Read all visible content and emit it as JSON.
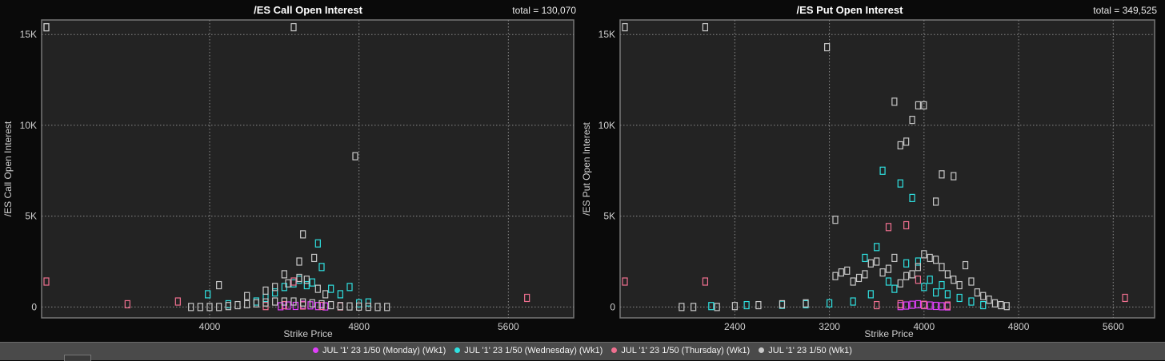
{
  "colors": {
    "background": "#0a0a0a",
    "plot_background": "#232323",
    "grid": "#8a8a8a",
    "monday": "#e040fb",
    "wednesday": "#2fe0e0",
    "thursday": "#f07090",
    "weekly": "#c8c8c8"
  },
  "legend": [
    {
      "label": "JUL '1' 23 1/50 (Monday) (Wk1)",
      "color": "#e040fb"
    },
    {
      "label": "JUL '1' 23 1/50 (Wednesday) (Wk1)",
      "color": "#2fe0e0"
    },
    {
      "label": "JUL '1' 23 1/50 (Thursday) (Wk1)",
      "color": "#f07090"
    },
    {
      "label": "JUL '1' 23 1/50 (Wk1)",
      "color": "#c8c8c8"
    }
  ],
  "chart_data": [
    {
      "type": "scatter",
      "title": "/ES Call Open Interest",
      "total_label": "total = 130,070",
      "xlabel": "Strike Price",
      "ylabel": "/ES Call Open Interest",
      "xlim": [
        3100,
        5950
      ],
      "ylim": [
        -600,
        15800
      ],
      "xticks": [
        4000,
        4800,
        5600
      ],
      "xtick_labels": [
        "4000",
        "4800",
        "5600"
      ],
      "yticks": [
        0,
        5000,
        10000,
        15000
      ],
      "ytick_labels": [
        "0",
        "5K",
        "10K",
        "15K"
      ],
      "grid": true,
      "series": [
        {
          "name": "JUL '1' 23 1/50 (Monday) (Wk1)",
          "color": "#e040fb",
          "x": [
            4380,
            4420,
            4460,
            4500,
            4540,
            4580,
            4620
          ],
          "y": [
            40,
            80,
            60,
            120,
            90,
            50,
            30
          ]
        },
        {
          "name": "JUL '1' 23 1/50 (Wednesday) (Wk1)",
          "color": "#2fe0e0",
          "x": [
            3990,
            4100,
            4250,
            4300,
            4350,
            4400,
            4450,
            4480,
            4520,
            4550,
            4580,
            4600,
            4650,
            4700,
            4750,
            4800,
            4850
          ],
          "y": [
            700,
            150,
            300,
            500,
            800,
            1100,
            1300,
            1500,
            1200,
            1350,
            3500,
            2200,
            1000,
            700,
            1100,
            200,
            250
          ]
        },
        {
          "name": "JUL '1' 23 1/50 (Thursday) (Wk1)",
          "color": "#f07090",
          "x": [
            3105,
            3560,
            3830,
            4450,
            5700,
            4300,
            4400,
            4500,
            4600,
            4700
          ],
          "y": [
            1400,
            150,
            300,
            1400,
            500,
            50,
            100,
            80,
            60,
            30
          ]
        },
        {
          "name": "JUL '1' 23 1/50 (Wk1)",
          "color": "#c8c8c8",
          "x": [
            3105,
            3100,
            4450,
            4780,
            4500,
            4050,
            4400,
            4480,
            4520,
            4560,
            3900,
            3950,
            4000,
            4050,
            4100,
            4150,
            4200,
            4250,
            4300,
            4350,
            4400,
            4450,
            4500,
            4550,
            4600,
            4650,
            4700,
            4750,
            4800,
            4850,
            4900,
            4950,
            4200,
            4300,
            4350,
            4420,
            4480,
            4580,
            4620
          ],
          "y": [
            15400,
            15400,
            15400,
            8300,
            4000,
            1200,
            1800,
            2500,
            1500,
            2700,
            0,
            0,
            0,
            0,
            50,
            100,
            150,
            200,
            250,
            300,
            300,
            300,
            250,
            200,
            150,
            100,
            50,
            30,
            20,
            10,
            0,
            0,
            600,
            900,
            1100,
            1300,
            1600,
            1000,
            700
          ]
        }
      ]
    },
    {
      "type": "scatter",
      "title": "/ES Put Open Interest",
      "total_label": "total = 349,525",
      "xlabel": "Strike Price",
      "ylabel": "/ES Put Open Interest",
      "xlim": [
        1430,
        5950
      ],
      "ylim": [
        -600,
        15800
      ],
      "xticks": [
        2400,
        3200,
        4000,
        4800,
        5600
      ],
      "xtick_labels": [
        "2400",
        "3200",
        "4000",
        "4800",
        "5600"
      ],
      "yticks": [
        0,
        5000,
        10000,
        15000
      ],
      "ytick_labels": [
        "0",
        "5K",
        "10K",
        "15K"
      ],
      "grid": true,
      "series": [
        {
          "name": "JUL '1' 23 1/50 (Monday) (Wk1)",
          "color": "#e040fb",
          "x": [
            3800,
            3850,
            3900,
            3950,
            4000,
            4050,
            4100,
            4150,
            4200
          ],
          "y": [
            50,
            80,
            120,
            150,
            100,
            80,
            60,
            40,
            30
          ]
        },
        {
          "name": "JUL '1' 23 1/50 (Wednesday) (Wk1)",
          "color": "#2fe0e0",
          "x": [
            2200,
            2500,
            2800,
            3000,
            3200,
            3400,
            3500,
            3550,
            3600,
            3650,
            3700,
            3750,
            3800,
            3850,
            3900,
            3950,
            4000,
            4050,
            4100,
            4150,
            4200,
            4300,
            4400,
            4500
          ],
          "y": [
            50,
            100,
            120,
            150,
            200,
            300,
            2700,
            700,
            3300,
            7500,
            1400,
            1000,
            6800,
            2400,
            6000,
            2500,
            1100,
            1500,
            800,
            1200,
            700,
            500,
            300,
            100
          ]
        },
        {
          "name": "JUL '1' 23 1/50 (Thursday) (Wk1)",
          "color": "#f07090",
          "x": [
            1450,
            2150,
            3700,
            3850,
            3950,
            5700,
            3600,
            3800,
            4000,
            4200
          ],
          "y": [
            1400,
            1400,
            4400,
            4500,
            1500,
            500,
            100,
            150,
            120,
            80
          ]
        },
        {
          "name": "JUL '1' 23 1/50 (Wk1)",
          "color": "#c8c8c8",
          "x": [
            1450,
            2150,
            3180,
            3750,
            3900,
            3950,
            4000,
            3850,
            3800,
            4150,
            4250,
            4100,
            3250,
            3250,
            3300,
            3350,
            3400,
            3450,
            3500,
            3550,
            3600,
            3650,
            3700,
            3750,
            3800,
            3850,
            3900,
            3950,
            4000,
            4050,
            4100,
            4150,
            4200,
            4250,
            4300,
            4350,
            4400,
            4450,
            4500,
            4550,
            4600,
            4650,
            4700,
            1950,
            2050,
            2250,
            2400,
            2600,
            2800,
            3000
          ],
          "y": [
            15400,
            15400,
            14300,
            11300,
            10300,
            11100,
            11100,
            9100,
            8900,
            7300,
            7200,
            5800,
            4800,
            1700,
            1900,
            2000,
            1400,
            1600,
            1800,
            2400,
            2500,
            1900,
            2100,
            2700,
            1300,
            1700,
            1800,
            2200,
            2900,
            2700,
            2600,
            2200,
            1800,
            1500,
            1200,
            2300,
            1400,
            800,
            600,
            400,
            200,
            100,
            50,
            0,
            0,
            0,
            50,
            100,
            150,
            200
          ]
        }
      ]
    }
  ]
}
